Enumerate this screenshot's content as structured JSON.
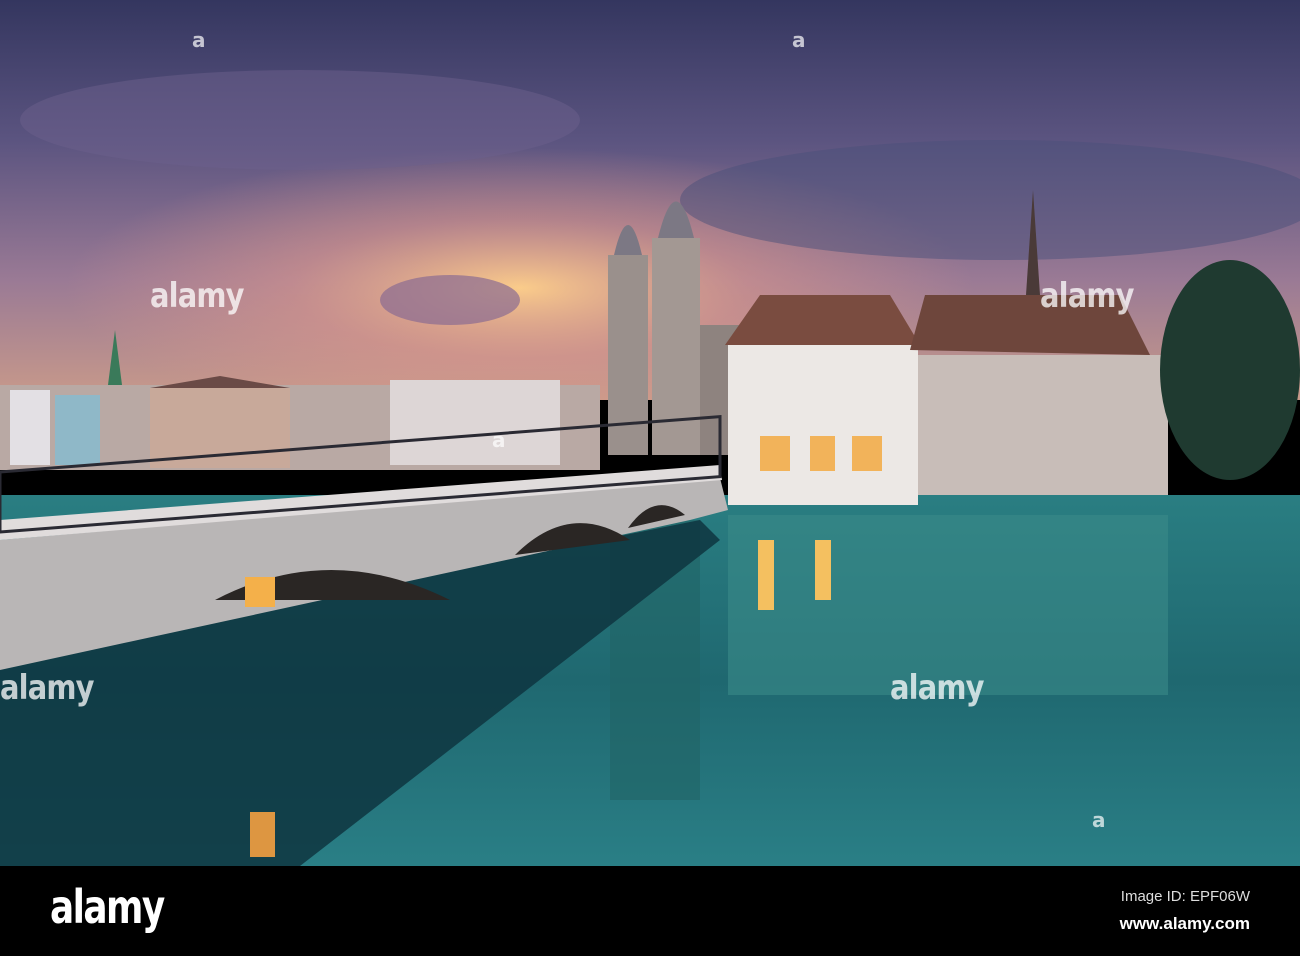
{
  "photo": {
    "subject": "Grossmünster and Wasserkirche beside Münsterbrücke over the Limmat at dusk",
    "watermark_text": "alamy",
    "watermark_mark": "a",
    "colors": {
      "sky_top": "#3b3f6e",
      "sky_glow": "#f0b37a",
      "water": "#1f6a70",
      "water_deep": "#0d2f3a"
    }
  },
  "footer": {
    "logo": "alamy",
    "image_id": "Image ID: EPF06W",
    "website": "www.alamy.com"
  }
}
